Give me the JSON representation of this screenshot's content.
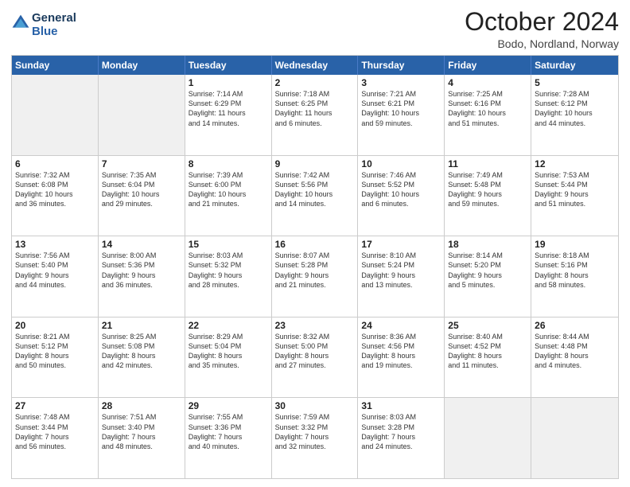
{
  "logo": {
    "line1": "General",
    "line2": "Blue"
  },
  "title": "October 2024",
  "subtitle": "Bodo, Nordland, Norway",
  "header_days": [
    "Sunday",
    "Monday",
    "Tuesday",
    "Wednesday",
    "Thursday",
    "Friday",
    "Saturday"
  ],
  "rows": [
    [
      {
        "day": "",
        "text": "",
        "shaded": true,
        "empty": true
      },
      {
        "day": "",
        "text": "",
        "shaded": true,
        "empty": true
      },
      {
        "day": "1",
        "text": "Sunrise: 7:14 AM\nSunset: 6:29 PM\nDaylight: 11 hours\nand 14 minutes."
      },
      {
        "day": "2",
        "text": "Sunrise: 7:18 AM\nSunset: 6:25 PM\nDaylight: 11 hours\nand 6 minutes."
      },
      {
        "day": "3",
        "text": "Sunrise: 7:21 AM\nSunset: 6:21 PM\nDaylight: 10 hours\nand 59 minutes."
      },
      {
        "day": "4",
        "text": "Sunrise: 7:25 AM\nSunset: 6:16 PM\nDaylight: 10 hours\nand 51 minutes."
      },
      {
        "day": "5",
        "text": "Sunrise: 7:28 AM\nSunset: 6:12 PM\nDaylight: 10 hours\nand 44 minutes."
      }
    ],
    [
      {
        "day": "6",
        "text": "Sunrise: 7:32 AM\nSunset: 6:08 PM\nDaylight: 10 hours\nand 36 minutes."
      },
      {
        "day": "7",
        "text": "Sunrise: 7:35 AM\nSunset: 6:04 PM\nDaylight: 10 hours\nand 29 minutes."
      },
      {
        "day": "8",
        "text": "Sunrise: 7:39 AM\nSunset: 6:00 PM\nDaylight: 10 hours\nand 21 minutes."
      },
      {
        "day": "9",
        "text": "Sunrise: 7:42 AM\nSunset: 5:56 PM\nDaylight: 10 hours\nand 14 minutes."
      },
      {
        "day": "10",
        "text": "Sunrise: 7:46 AM\nSunset: 5:52 PM\nDaylight: 10 hours\nand 6 minutes."
      },
      {
        "day": "11",
        "text": "Sunrise: 7:49 AM\nSunset: 5:48 PM\nDaylight: 9 hours\nand 59 minutes."
      },
      {
        "day": "12",
        "text": "Sunrise: 7:53 AM\nSunset: 5:44 PM\nDaylight: 9 hours\nand 51 minutes."
      }
    ],
    [
      {
        "day": "13",
        "text": "Sunrise: 7:56 AM\nSunset: 5:40 PM\nDaylight: 9 hours\nand 44 minutes."
      },
      {
        "day": "14",
        "text": "Sunrise: 8:00 AM\nSunset: 5:36 PM\nDaylight: 9 hours\nand 36 minutes."
      },
      {
        "day": "15",
        "text": "Sunrise: 8:03 AM\nSunset: 5:32 PM\nDaylight: 9 hours\nand 28 minutes."
      },
      {
        "day": "16",
        "text": "Sunrise: 8:07 AM\nSunset: 5:28 PM\nDaylight: 9 hours\nand 21 minutes."
      },
      {
        "day": "17",
        "text": "Sunrise: 8:10 AM\nSunset: 5:24 PM\nDaylight: 9 hours\nand 13 minutes."
      },
      {
        "day": "18",
        "text": "Sunrise: 8:14 AM\nSunset: 5:20 PM\nDaylight: 9 hours\nand 5 minutes."
      },
      {
        "day": "19",
        "text": "Sunrise: 8:18 AM\nSunset: 5:16 PM\nDaylight: 8 hours\nand 58 minutes."
      }
    ],
    [
      {
        "day": "20",
        "text": "Sunrise: 8:21 AM\nSunset: 5:12 PM\nDaylight: 8 hours\nand 50 minutes."
      },
      {
        "day": "21",
        "text": "Sunrise: 8:25 AM\nSunset: 5:08 PM\nDaylight: 8 hours\nand 42 minutes."
      },
      {
        "day": "22",
        "text": "Sunrise: 8:29 AM\nSunset: 5:04 PM\nDaylight: 8 hours\nand 35 minutes."
      },
      {
        "day": "23",
        "text": "Sunrise: 8:32 AM\nSunset: 5:00 PM\nDaylight: 8 hours\nand 27 minutes."
      },
      {
        "day": "24",
        "text": "Sunrise: 8:36 AM\nSunset: 4:56 PM\nDaylight: 8 hours\nand 19 minutes."
      },
      {
        "day": "25",
        "text": "Sunrise: 8:40 AM\nSunset: 4:52 PM\nDaylight: 8 hours\nand 11 minutes."
      },
      {
        "day": "26",
        "text": "Sunrise: 8:44 AM\nSunset: 4:48 PM\nDaylight: 8 hours\nand 4 minutes."
      }
    ],
    [
      {
        "day": "27",
        "text": "Sunrise: 7:48 AM\nSunset: 3:44 PM\nDaylight: 7 hours\nand 56 minutes."
      },
      {
        "day": "28",
        "text": "Sunrise: 7:51 AM\nSunset: 3:40 PM\nDaylight: 7 hours\nand 48 minutes."
      },
      {
        "day": "29",
        "text": "Sunrise: 7:55 AM\nSunset: 3:36 PM\nDaylight: 7 hours\nand 40 minutes."
      },
      {
        "day": "30",
        "text": "Sunrise: 7:59 AM\nSunset: 3:32 PM\nDaylight: 7 hours\nand 32 minutes."
      },
      {
        "day": "31",
        "text": "Sunrise: 8:03 AM\nSunset: 3:28 PM\nDaylight: 7 hours\nand 24 minutes."
      },
      {
        "day": "",
        "text": "",
        "shaded": true,
        "empty": true
      },
      {
        "day": "",
        "text": "",
        "shaded": true,
        "empty": true
      }
    ]
  ]
}
